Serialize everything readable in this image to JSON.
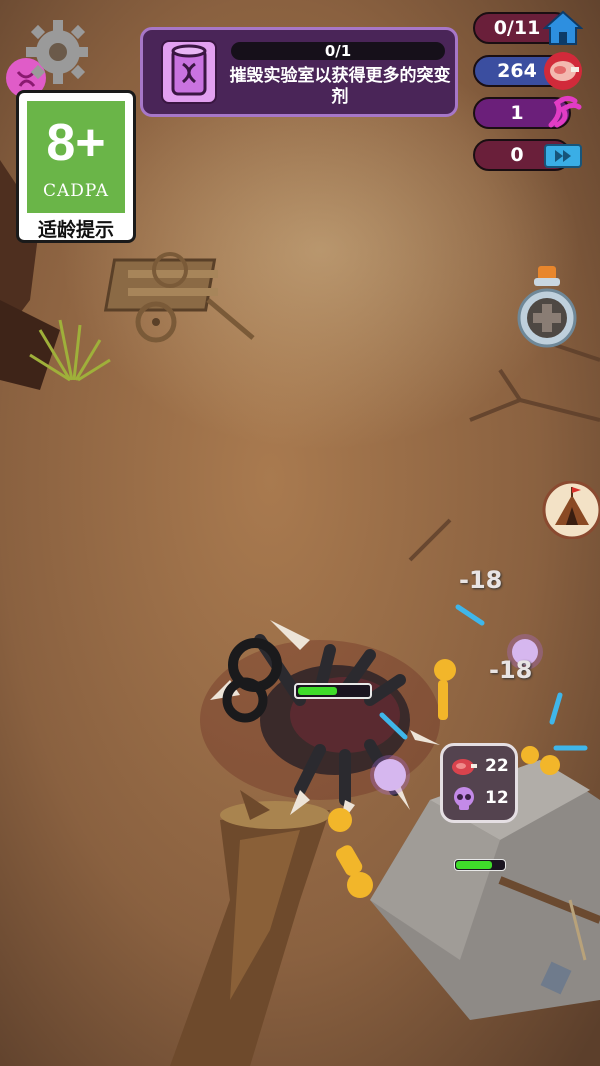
{
  "mission": {
    "progress_text": "0/1",
    "description": "摧毁实验室以获得更多的突变剂",
    "icon": "dna-canister-icon"
  },
  "settings": {
    "icon": "gear-icon"
  },
  "age_rating": {
    "rating": "8+",
    "org": "CADPA",
    "tip": "适龄提示"
  },
  "counters": [
    {
      "name": "labs-destroyed",
      "value": "0/11",
      "icon": "house-icon",
      "color": "#6a1f3a"
    },
    {
      "name": "meat",
      "value": "264",
      "icon": "meat-icon",
      "color": "#3b4ea0"
    },
    {
      "name": "dna",
      "value": "1",
      "icon": "dna-icon",
      "color": "#6b1f7a"
    },
    {
      "name": "speed-tickets",
      "value": "0",
      "icon": "fast-forward-ticket-icon",
      "color": "#6a1f3a"
    }
  ],
  "side_buttons": {
    "potion": "potion-bottle-icon",
    "camp": "camp-tent-icon"
  },
  "damage_numbers": [
    "-18",
    "-18"
  ],
  "loot": {
    "meat": "22",
    "skulls": "12"
  },
  "player_health": 0.55,
  "enemy_health": 0.75
}
